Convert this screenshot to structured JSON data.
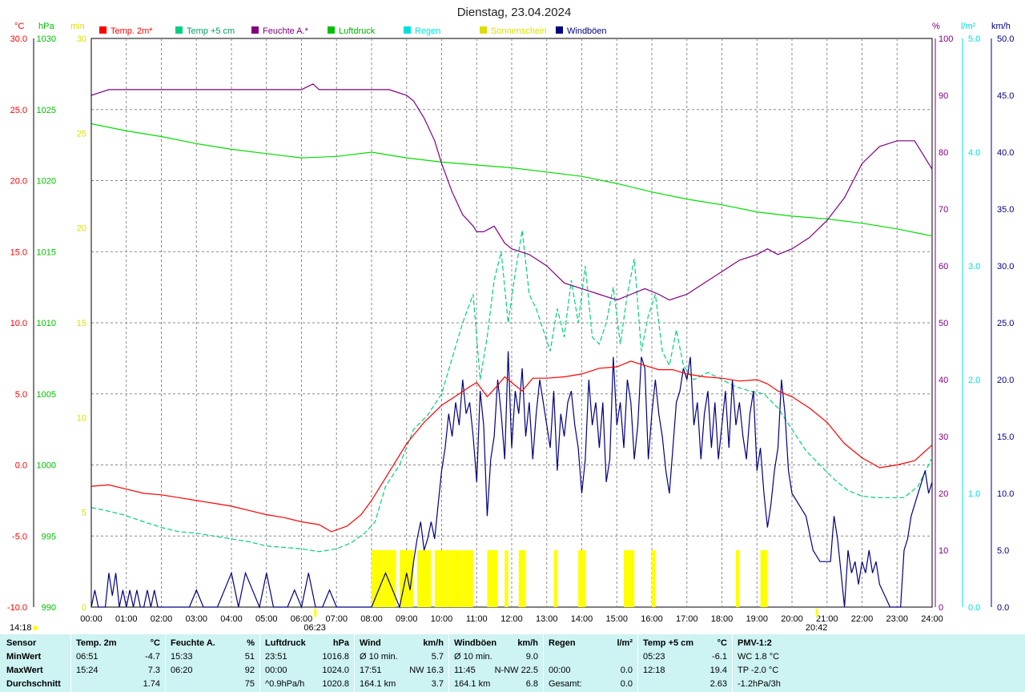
{
  "chart_data": {
    "type": "line",
    "title": "Dienstag, 23.04.2024",
    "x_ticks": [
      "00:00",
      "01:00",
      "02:00",
      "03:00",
      "04:00",
      "05:00",
      "06:00",
      "07:00",
      "08:00",
      "09:00",
      "10:00",
      "11:00",
      "12:00",
      "13:00",
      "14:00",
      "15:00",
      "16:00",
      "17:00",
      "18:00",
      "19:00",
      "20:00",
      "21:00",
      "22:00",
      "23:00",
      "24:00"
    ],
    "left_axes": [
      {
        "unit": "°C",
        "color": "#ff0000",
        "ticks": [
          "30.0",
          "25.0",
          "20.0",
          "15.0",
          "10.0",
          "5.0",
          "0.0",
          "-5.0",
          "-10.0"
        ],
        "ylim": [
          -10,
          30
        ]
      },
      {
        "unit": "hPa",
        "color": "#00c000",
        "ticks": [
          "1030",
          "1025",
          "1020",
          "1015",
          "1010",
          "1005",
          "1000",
          "995",
          "990"
        ],
        "ylim": [
          990,
          1030
        ]
      },
      {
        "unit": "min",
        "color": "#dddd00",
        "ticks": [
          "30",
          "25",
          "20",
          "15",
          "10",
          "5",
          "0"
        ],
        "ylim": [
          0,
          30
        ]
      }
    ],
    "right_axes": [
      {
        "unit": "%",
        "color": "#800080",
        "ticks": [
          "100",
          "90",
          "80",
          "70",
          "60",
          "50",
          "40",
          "30",
          "20",
          "10",
          "0"
        ],
        "ylim": [
          0,
          100
        ]
      },
      {
        "unit": "l/m²",
        "color": "#00e0e0",
        "ticks": [
          "5.0",
          "4.0",
          "3.0",
          "2.0",
          "1.0",
          "0.0"
        ],
        "ylim": [
          0,
          5
        ]
      },
      {
        "unit": "km/h",
        "color": "#000080",
        "ticks": [
          "50.0",
          "45.0",
          "40.0",
          "35.0",
          "30.0",
          "25.0",
          "20.0",
          "15.0",
          "10.0",
          "5.0",
          "0.0"
        ],
        "ylim": [
          0,
          50
        ]
      }
    ],
    "legend": [
      {
        "name": "Temp. 2m*",
        "color": "#ff0000"
      },
      {
        "name": "Temp +5 cm",
        "color": "#00d080"
      },
      {
        "name": "Feuchte A.*",
        "color": "#800080"
      },
      {
        "name": "Luftdruck",
        "color": "#00c000"
      },
      {
        "name": "Regen",
        "color": "#00e0e0"
      },
      {
        "name": "Sonnenschein",
        "color": "#dddd00"
      },
      {
        "name": "Windböen",
        "color": "#000080"
      }
    ],
    "series": {
      "temp_2m": {
        "axis": "°C",
        "x": [
          0,
          0.5,
          1,
          1.5,
          2,
          2.5,
          3,
          3.5,
          4,
          4.5,
          5,
          5.5,
          6,
          6.5,
          6.85,
          7.3,
          7.7,
          8,
          8.5,
          9,
          9.5,
          10,
          10.5,
          10.8,
          11,
          11.3,
          11.6,
          11.8,
          12,
          12.3,
          12.6,
          13,
          13.5,
          14,
          14.5,
          15,
          15.4,
          15.8,
          16.2,
          16.6,
          17,
          17.5,
          18,
          18.5,
          19,
          19.3,
          19.6,
          20,
          20.5,
          21,
          21.5,
          22,
          22.5,
          23,
          23.5,
          24
        ],
        "y": [
          -1.5,
          -1.4,
          -1.7,
          -2.0,
          -2.1,
          -2.3,
          -2.5,
          -2.7,
          -2.9,
          -3.2,
          -3.5,
          -3.7,
          -4.0,
          -4.2,
          -4.7,
          -4.3,
          -3.5,
          -2.5,
          -0.5,
          1.5,
          3.0,
          4.2,
          5.0,
          5.5,
          5.8,
          4.8,
          5.6,
          6.2,
          5.8,
          5.2,
          6.1,
          6.1,
          6.2,
          6.4,
          6.8,
          6.9,
          7.3,
          7.0,
          6.7,
          6.7,
          6.4,
          6.2,
          6.1,
          5.9,
          6.0,
          5.7,
          5.2,
          4.8,
          4.0,
          3.0,
          1.5,
          0.5,
          -0.2,
          0.0,
          0.3,
          1.4
        ]
      },
      "temp_5cm": {
        "axis": "°C",
        "x": [
          0,
          0.4,
          0.9,
          1.5,
          2,
          2.5,
          3,
          3.5,
          4,
          4.5,
          5,
          5.5,
          6,
          6.5,
          7,
          7.4,
          7.8,
          8.1,
          8.4,
          8.8,
          9.2,
          9.6,
          10,
          10.3,
          10.6,
          10.9,
          11.1,
          11.3,
          11.5,
          11.7,
          11.9,
          12.1,
          12.3,
          12.5,
          12.7,
          12.9,
          13.1,
          13.3,
          13.5,
          13.7,
          13.9,
          14.1,
          14.3,
          14.5,
          14.7,
          14.9,
          15.1,
          15.3,
          15.5,
          15.7,
          15.9,
          16.1,
          16.3,
          16.5,
          16.7,
          16.9,
          17.2,
          17.6,
          18,
          18.4,
          18.8,
          19.2,
          19.6,
          20,
          20.4,
          20.8,
          21.2,
          21.6,
          22,
          22.4,
          22.8,
          23.2,
          23.6,
          24
        ],
        "y": [
          -3.0,
          -3.2,
          -3.5,
          -4.0,
          -4.4,
          -4.7,
          -4.8,
          -5.0,
          -5.2,
          -5.4,
          -5.7,
          -5.8,
          -5.9,
          -6.1,
          -5.9,
          -5.5,
          -4.8,
          -4.0,
          -1.5,
          0.0,
          2.5,
          3.5,
          5.0,
          7.5,
          10.0,
          12.0,
          6.0,
          9.0,
          13.0,
          15.0,
          10.0,
          13.5,
          16.5,
          12.0,
          11.0,
          9.5,
          8.0,
          11.0,
          9.0,
          13.0,
          10.0,
          14.0,
          9.0,
          8.5,
          10.0,
          12.5,
          8.5,
          12.0,
          14.5,
          8.0,
          10.5,
          12.0,
          8.0,
          7.0,
          9.5,
          7.0,
          6.0,
          6.5,
          6.0,
          5.5,
          5.2,
          5.0,
          4.0,
          2.5,
          1.0,
          0.0,
          -1.0,
          -1.8,
          -2.2,
          -2.3,
          -2.3,
          -2.3,
          -1.5,
          0.5
        ]
      },
      "feuchte": {
        "axis": "%",
        "x": [
          0,
          0.5,
          1,
          2,
          3,
          4,
          5,
          6,
          6.33,
          6.5,
          7,
          7.5,
          8,
          8.5,
          9,
          9.2,
          9.5,
          9.8,
          10,
          10.3,
          10.6,
          10.9,
          11,
          11.2,
          11.5,
          11.8,
          12,
          12.5,
          13,
          13.5,
          14,
          14.5,
          15,
          15.4,
          15.8,
          16.2,
          16.5,
          17,
          17.5,
          18,
          18.5,
          19,
          19.3,
          19.6,
          20,
          20.5,
          21,
          21.5,
          22,
          22.5,
          23,
          23.5,
          24
        ],
        "y": [
          90,
          91,
          91,
          91,
          91,
          91,
          91,
          91,
          92,
          91,
          91,
          91,
          91,
          91,
          90,
          89,
          86,
          82,
          78,
          73,
          69,
          67,
          66,
          66,
          67,
          64,
          63,
          62,
          60,
          57,
          56,
          55,
          54,
          55,
          56,
          55,
          54,
          55,
          57,
          59,
          61,
          62,
          63,
          62,
          63,
          65,
          68,
          72,
          78,
          81,
          82,
          82,
          77
        ]
      },
      "luftdruck": {
        "axis": "hPa",
        "x": [
          0,
          1,
          2,
          3,
          4,
          5,
          6,
          7,
          8,
          9,
          10,
          11,
          12,
          13,
          14,
          15,
          16,
          17,
          18,
          19,
          20,
          21,
          22,
          23,
          24
        ],
        "y": [
          1024.0,
          1023.5,
          1023.1,
          1022.6,
          1022.2,
          1021.9,
          1021.6,
          1021.7,
          1022.0,
          1021.6,
          1021.3,
          1021.1,
          1020.9,
          1020.6,
          1020.3,
          1019.8,
          1019.2,
          1018.7,
          1018.3,
          1017.8,
          1017.5,
          1017.3,
          1017.0,
          1016.6,
          1016.1
        ]
      },
      "windboeen": {
        "axis": "km/h",
        "x": [
          0,
          0.1,
          0.2,
          0.4,
          0.5,
          0.6,
          0.7,
          0.8,
          0.9,
          1,
          1.1,
          1.2,
          1.3,
          1.4,
          1.5,
          1.6,
          1.7,
          1.8,
          1.9,
          2,
          2.5,
          2.8,
          3,
          3.2,
          3.4,
          3.6,
          3.8,
          4,
          4.1,
          4.2,
          4.4,
          4.6,
          4.8,
          5,
          5.2,
          5.4,
          5.6,
          5.8,
          6,
          6.2,
          6.4,
          6.6,
          6.8,
          7,
          7.4,
          7.8,
          8,
          8.2,
          8.4,
          8.6,
          8.8,
          9,
          9.1,
          9.2,
          9.3,
          9.4,
          9.5,
          9.6,
          9.7,
          9.8,
          9.9,
          10,
          10.1,
          10.2,
          10.3,
          10.4,
          10.5,
          10.6,
          10.7,
          10.8,
          10.9,
          11,
          11.1,
          11.2,
          11.3,
          11.4,
          11.5,
          11.6,
          11.7,
          11.8,
          11.9,
          12,
          12.1,
          12.2,
          12.3,
          12.4,
          12.5,
          12.6,
          12.7,
          12.8,
          12.9,
          13,
          13.1,
          13.2,
          13.3,
          13.4,
          13.5,
          13.6,
          13.7,
          13.8,
          13.9,
          14,
          14.1,
          14.2,
          14.3,
          14.4,
          14.5,
          14.6,
          14.7,
          14.8,
          14.9,
          15,
          15.1,
          15.2,
          15.3,
          15.4,
          15.5,
          15.6,
          15.7,
          15.8,
          15.9,
          16,
          16.1,
          16.2,
          16.3,
          16.4,
          16.5,
          16.6,
          16.7,
          16.8,
          16.9,
          17,
          17.1,
          17.2,
          17.3,
          17.4,
          17.5,
          17.6,
          17.7,
          17.8,
          17.9,
          18,
          18.1,
          18.2,
          18.3,
          18.4,
          18.5,
          18.6,
          18.7,
          18.8,
          18.9,
          19,
          19.1,
          19.2,
          19.3,
          19.4,
          19.5,
          19.6,
          19.7,
          19.8,
          19.9,
          20,
          20.2,
          20.4,
          20.6,
          20.8,
          21,
          21.1,
          21.2,
          21.3,
          21.4,
          21.5,
          21.6,
          21.7,
          21.8,
          21.9,
          22,
          22.1,
          22.2,
          22.3,
          22.4,
          22.5,
          22.8,
          23,
          23.1,
          23.2,
          23.3,
          23.4,
          23.5,
          23.6,
          23.7,
          23.8,
          23.9,
          24
        ],
        "y": [
          0,
          1.5,
          0,
          0,
          3,
          1,
          3,
          0,
          1.5,
          0,
          1.5,
          0,
          1.5,
          0,
          0,
          1.5,
          0,
          1.5,
          0,
          0,
          0,
          0,
          1.5,
          0,
          0,
          0,
          1.5,
          3,
          1.5,
          0,
          3,
          1.5,
          0,
          3,
          0,
          0,
          0,
          1.5,
          0,
          3,
          0,
          0,
          1.5,
          0,
          0,
          0,
          0,
          1.5,
          3,
          1.5,
          0,
          3,
          1.5,
          4,
          6,
          7.5,
          5,
          6,
          7.5,
          6,
          9,
          12,
          14,
          17,
          15,
          18,
          16,
          20,
          17,
          18,
          15,
          11,
          19,
          16,
          8,
          13,
          15,
          20,
          17,
          13,
          22.5,
          14,
          19,
          17,
          21,
          15,
          18,
          13,
          17,
          20,
          18,
          16,
          14,
          19,
          12,
          17,
          15,
          18,
          19,
          16,
          14,
          10,
          13,
          20,
          16,
          18,
          14,
          18,
          11,
          13,
          22,
          16,
          18,
          14,
          20,
          18,
          13,
          16,
          22,
          21,
          13,
          17,
          20,
          17,
          15,
          12,
          10,
          14,
          18,
          19,
          21,
          20,
          22,
          16,
          18,
          13,
          17,
          19,
          14,
          18,
          13,
          16,
          19,
          14,
          20,
          16,
          18,
          15,
          13,
          17,
          19,
          12,
          14,
          10,
          7,
          9,
          12,
          14,
          20,
          17,
          12,
          10,
          9,
          8,
          5,
          4,
          4,
          4,
          8,
          6,
          3,
          0,
          5,
          3,
          4,
          2,
          4,
          3,
          5,
          3,
          4,
          2,
          0,
          0,
          0,
          5,
          6,
          8,
          9,
          10,
          11,
          12,
          10,
          11
        ]
      },
      "sonnenschein_windows": [
        [
          8.0,
          8.3
        ],
        [
          8.3,
          8.7
        ],
        [
          8.8,
          9.2
        ],
        [
          9.3,
          9.7
        ],
        [
          9.8,
          10.2
        ],
        [
          10.2,
          10.6
        ],
        [
          10.6,
          10.9
        ],
        [
          11.3,
          11.6
        ],
        [
          11.8,
          11.9
        ],
        [
          12.2,
          12.4
        ],
        [
          13.2,
          13.3
        ],
        [
          13.9,
          14.1
        ],
        [
          15.2,
          15.5
        ],
        [
          16.0,
          16.1
        ],
        [
          18.4,
          18.5
        ],
        [
          19.1,
          19.3
        ]
      ]
    },
    "x_markers": [
      {
        "label": "06:23",
        "x": 6.38
      },
      {
        "label": "20:42",
        "x": 20.7
      }
    ],
    "corner_label": "14:18"
  },
  "table": {
    "rows": [
      {
        "label": "Sensor",
        "cells": [
          [
            "Temp. 2m",
            "°C"
          ],
          [
            "Feuchte A.",
            "%"
          ],
          [
            "Luftdruck",
            "hPa"
          ],
          [
            "Wind",
            "km/h"
          ],
          [
            "Windböen",
            "km/h"
          ],
          [
            "Regen",
            "l/m²"
          ],
          [
            "Temp +5 cm",
            "°C"
          ],
          [
            "PMV-1:2",
            ""
          ]
        ]
      },
      {
        "label": "MinWert",
        "cells": [
          [
            "06:51",
            "-4.7"
          ],
          [
            "15:33",
            "51"
          ],
          [
            "23:51",
            "1016.8"
          ],
          [
            "Ø 10 min.",
            "5.7"
          ],
          [
            "Ø 10 min.",
            "9.0"
          ],
          [
            "",
            ""
          ],
          [
            "05:23",
            "-6.1"
          ],
          [
            "WC 1.8 °C",
            ""
          ]
        ]
      },
      {
        "label": "MaxWert",
        "cells": [
          [
            "15:24",
            "7.3"
          ],
          [
            "06:20",
            "92"
          ],
          [
            "00:00",
            "1024.0"
          ],
          [
            "17:51",
            "NW 16.3"
          ],
          [
            "11:45",
            "N-NW 22.5"
          ],
          [
            "00:00",
            "0.0"
          ],
          [
            "12:18",
            "19.4"
          ],
          [
            "TP -2.0 °C",
            ""
          ]
        ]
      },
      {
        "label": "Durchschnitt",
        "cells": [
          [
            "",
            "1.74"
          ],
          [
            "",
            "75"
          ],
          [
            "^0.9hPa/h",
            "1020.8"
          ],
          [
            "164.1 km",
            "3.7"
          ],
          [
            "164.1 km",
            "6.8"
          ],
          [
            "Gesamt:",
            "0.0"
          ],
          [
            "",
            "2.63"
          ],
          [
            "-1.2hPa/3h",
            ""
          ]
        ]
      }
    ]
  }
}
